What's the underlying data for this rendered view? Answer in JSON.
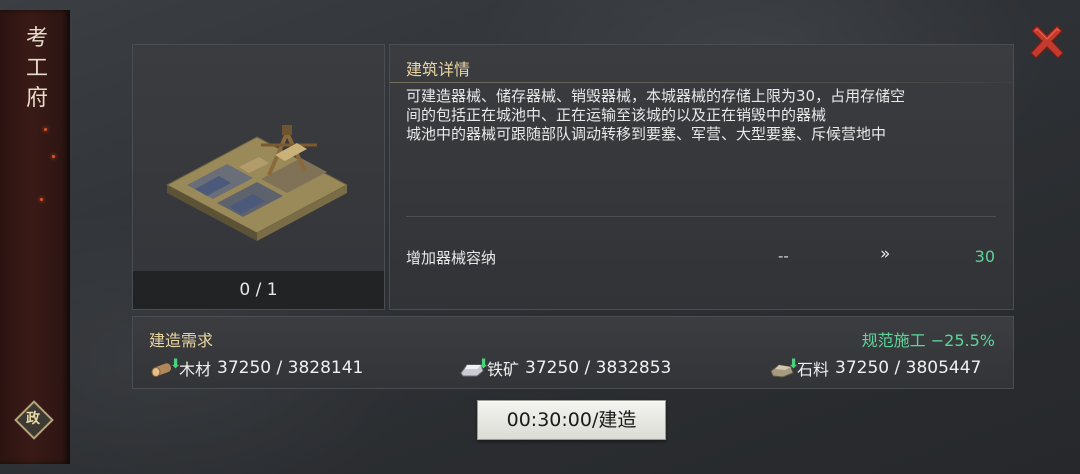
{
  "window": {
    "title_chars": [
      "考",
      "工",
      "府"
    ],
    "policy_badge": "政",
    "close_icon": "close-x-icon"
  },
  "building": {
    "count": "0 / 1"
  },
  "detail": {
    "title": "建筑详情",
    "description": [
      "可建造器械、储存器械、销毁器械，本城器械的存储上限为30，占用存储空",
      "间的包括正在城池中、正在运输至该城的以及正在销毁中的器械",
      "城池中的器械可跟随部队调动转移到要塞、军营、大型要塞、斥候营地中"
    ],
    "stat": {
      "label": "增加器械容纳",
      "current": "--",
      "arrow": "»",
      "next": "30"
    }
  },
  "requirements": {
    "title": "建造需求",
    "discount": "规范施工 −25.5%",
    "resources": [
      {
        "icon": "wood-icon",
        "name": "木材",
        "amount": "37250 / 3828141"
      },
      {
        "icon": "iron-ore-icon",
        "name": "铁矿",
        "amount": "37250 / 3832853"
      },
      {
        "icon": "stone-icon",
        "name": "石料",
        "amount": "37250 / 3805447"
      }
    ]
  },
  "build_button": {
    "label": "00:30:00/建造"
  },
  "colors": {
    "accent_gold": "#e9d5a2",
    "green": "#5fd49a",
    "close_red": "#c43a2c"
  }
}
